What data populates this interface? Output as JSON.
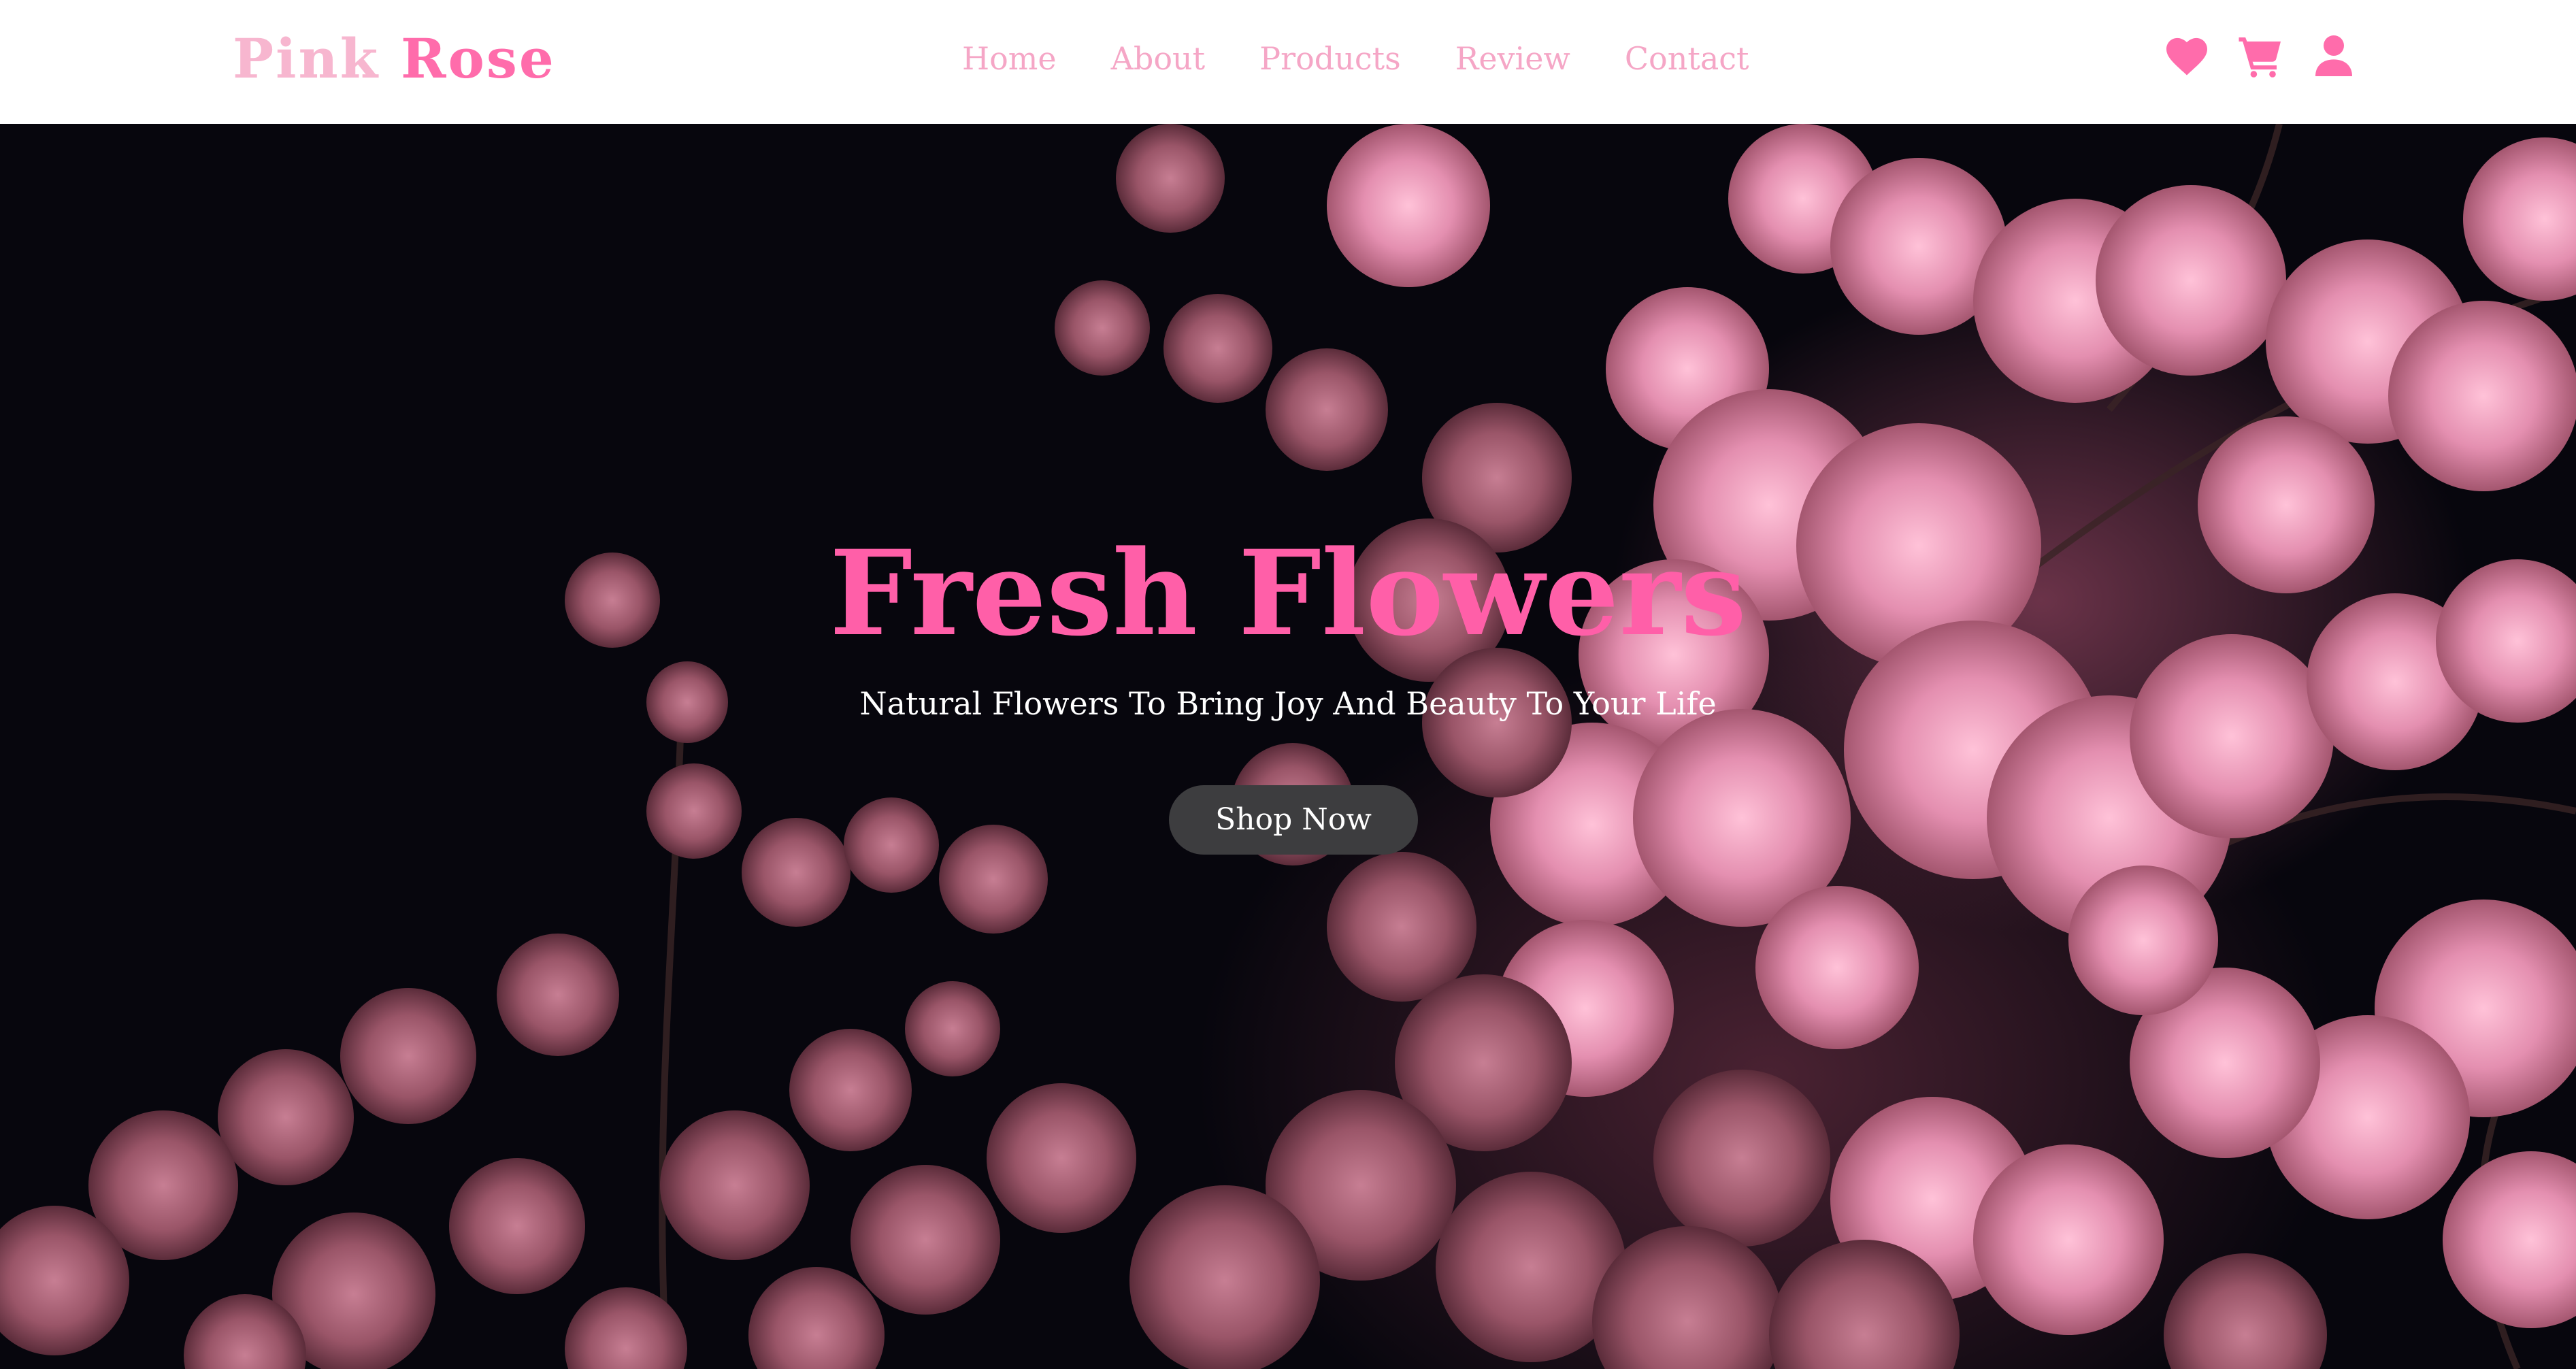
{
  "brand": {
    "word1": "Pink",
    "word2": "Rose"
  },
  "nav": {
    "links": [
      {
        "label": "Home"
      },
      {
        "label": "About"
      },
      {
        "label": "Products"
      },
      {
        "label": "Review"
      },
      {
        "label": "Contact"
      }
    ]
  },
  "header_icons": [
    "heart-icon",
    "cart-icon",
    "user-icon"
  ],
  "hero": {
    "title": "Fresh Flowers",
    "subtitle": "Natural Flowers To Bring Joy And Beauty To Your Life",
    "cta_label": "Shop Now",
    "background_image": "pink cherry blossoms against a dark night sky"
  },
  "colors": {
    "brand_light": "#f7b6cf",
    "brand_accent": "#ff6cab",
    "nav_link": "#f5a6c6",
    "hero_title": "#ff5fa8",
    "button_bg": "#3d3d3f",
    "hero_bg": "#07060d"
  }
}
